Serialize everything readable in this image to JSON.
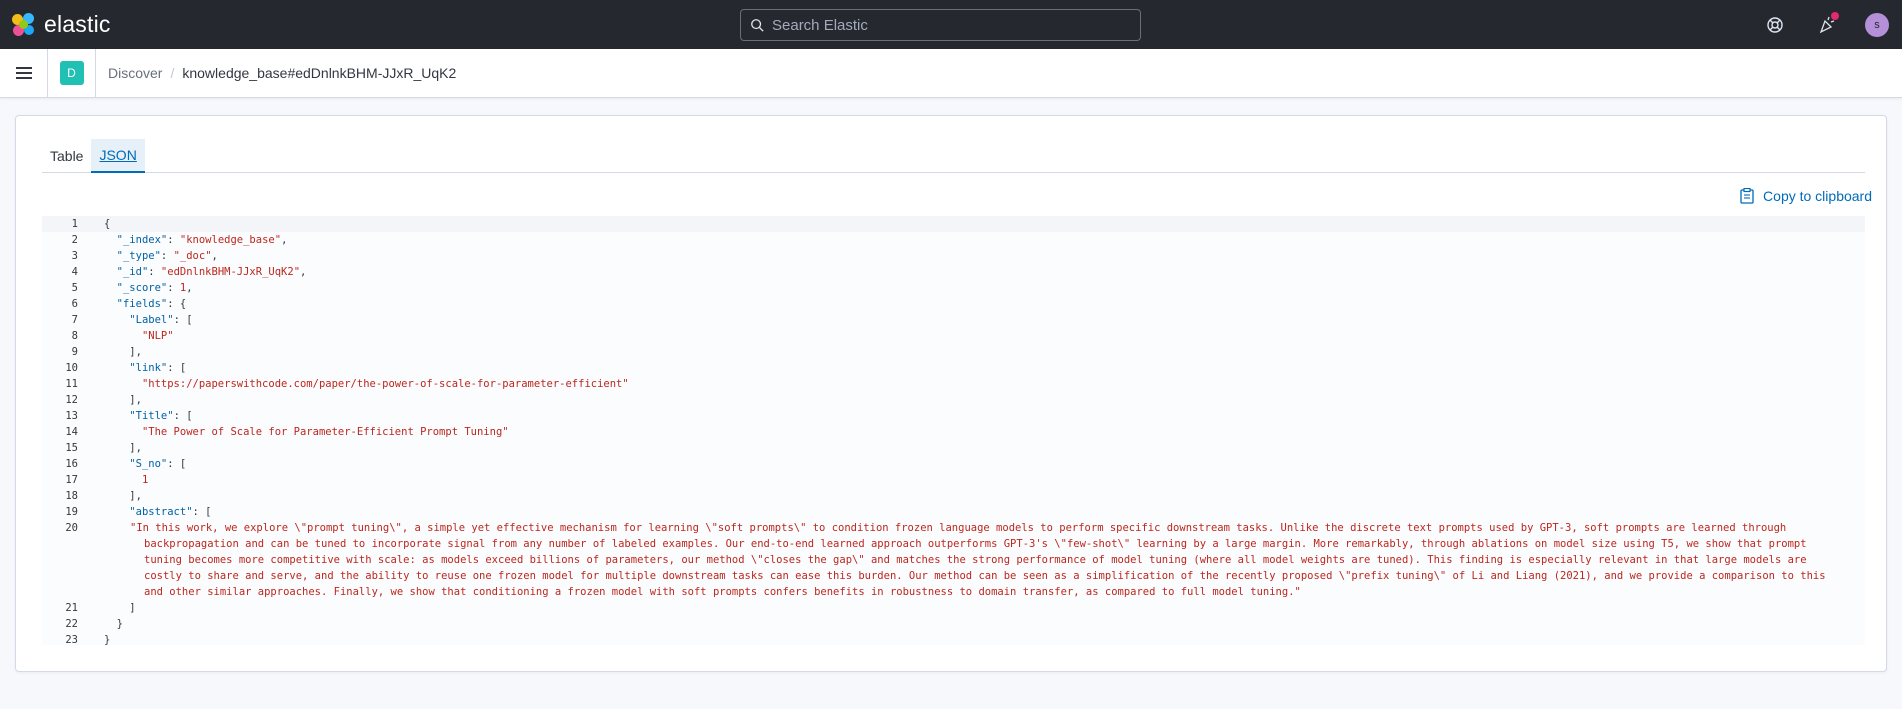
{
  "header": {
    "brand": "elastic",
    "search_placeholder": "Search Elastic",
    "avatar_initial": "s",
    "accent_colors": {
      "dark_bg": "#25282f",
      "notify": "#e7296e",
      "avatar": "#b490d9"
    }
  },
  "breadcrumb": {
    "app_badge": "D",
    "items": [
      "Discover",
      "knowledge_base#edDnlnkBHM-JJxR_UqK2"
    ]
  },
  "tabs": [
    {
      "label": "Table",
      "active": false
    },
    {
      "label": "JSON",
      "active": true
    }
  ],
  "copy_button": "Copy to clipboard",
  "code": {
    "line_numbers": [
      "1",
      "2",
      "3",
      "4",
      "5",
      "6",
      "7",
      "8",
      "9",
      "10",
      "11",
      "12",
      "13",
      "14",
      "15",
      "16",
      "17",
      "18",
      "19",
      "20",
      "21",
      "22",
      "23"
    ],
    "doc": {
      "_index": "knowledge_base",
      "_type": "_doc",
      "_id": "edDnlnkBHM-JJxR_UqK2",
      "_score": "1",
      "label": "NLP",
      "link": "https://paperswithcode.com/paper/the-power-of-scale-for-parameter-efficient",
      "title": "The Power of Scale for Parameter-Efficient Prompt Tuning",
      "s_no": "1",
      "abstract": "In this work, we explore \\\"prompt tuning\\\", a simple yet effective mechanism for learning \\\"soft prompts\\\" to condition frozen language models to perform specific downstream tasks. Unlike the discrete text prompts used by GPT-3, soft prompts are learned through backpropagation and can be tuned to incorporate signal from any number of labeled examples. Our end-to-end learned approach outperforms GPT-3's \\\"few-shot\\\" learning by a large margin. More remarkably, through ablations on model size using T5, we show that prompt tuning becomes more competitive with scale: as models exceed billions of parameters, our method \\\"closes the gap\\\" and matches the strong performance of model tuning (where all model weights are tuned). This finding is especially relevant in that large models are costly to share and serve, and the ability to reuse one frozen model for multiple downstream tasks can ease this burden. Our method can be seen as a simplification of the recently proposed \\\"prefix tuning\\\" of Li and Liang (2021), and we provide a comparison to this and other similar approaches. Finally, we show that conditioning a frozen model with soft prompts confers benefits in robustness to domain transfer, as compared to full model tuning."
    }
  }
}
